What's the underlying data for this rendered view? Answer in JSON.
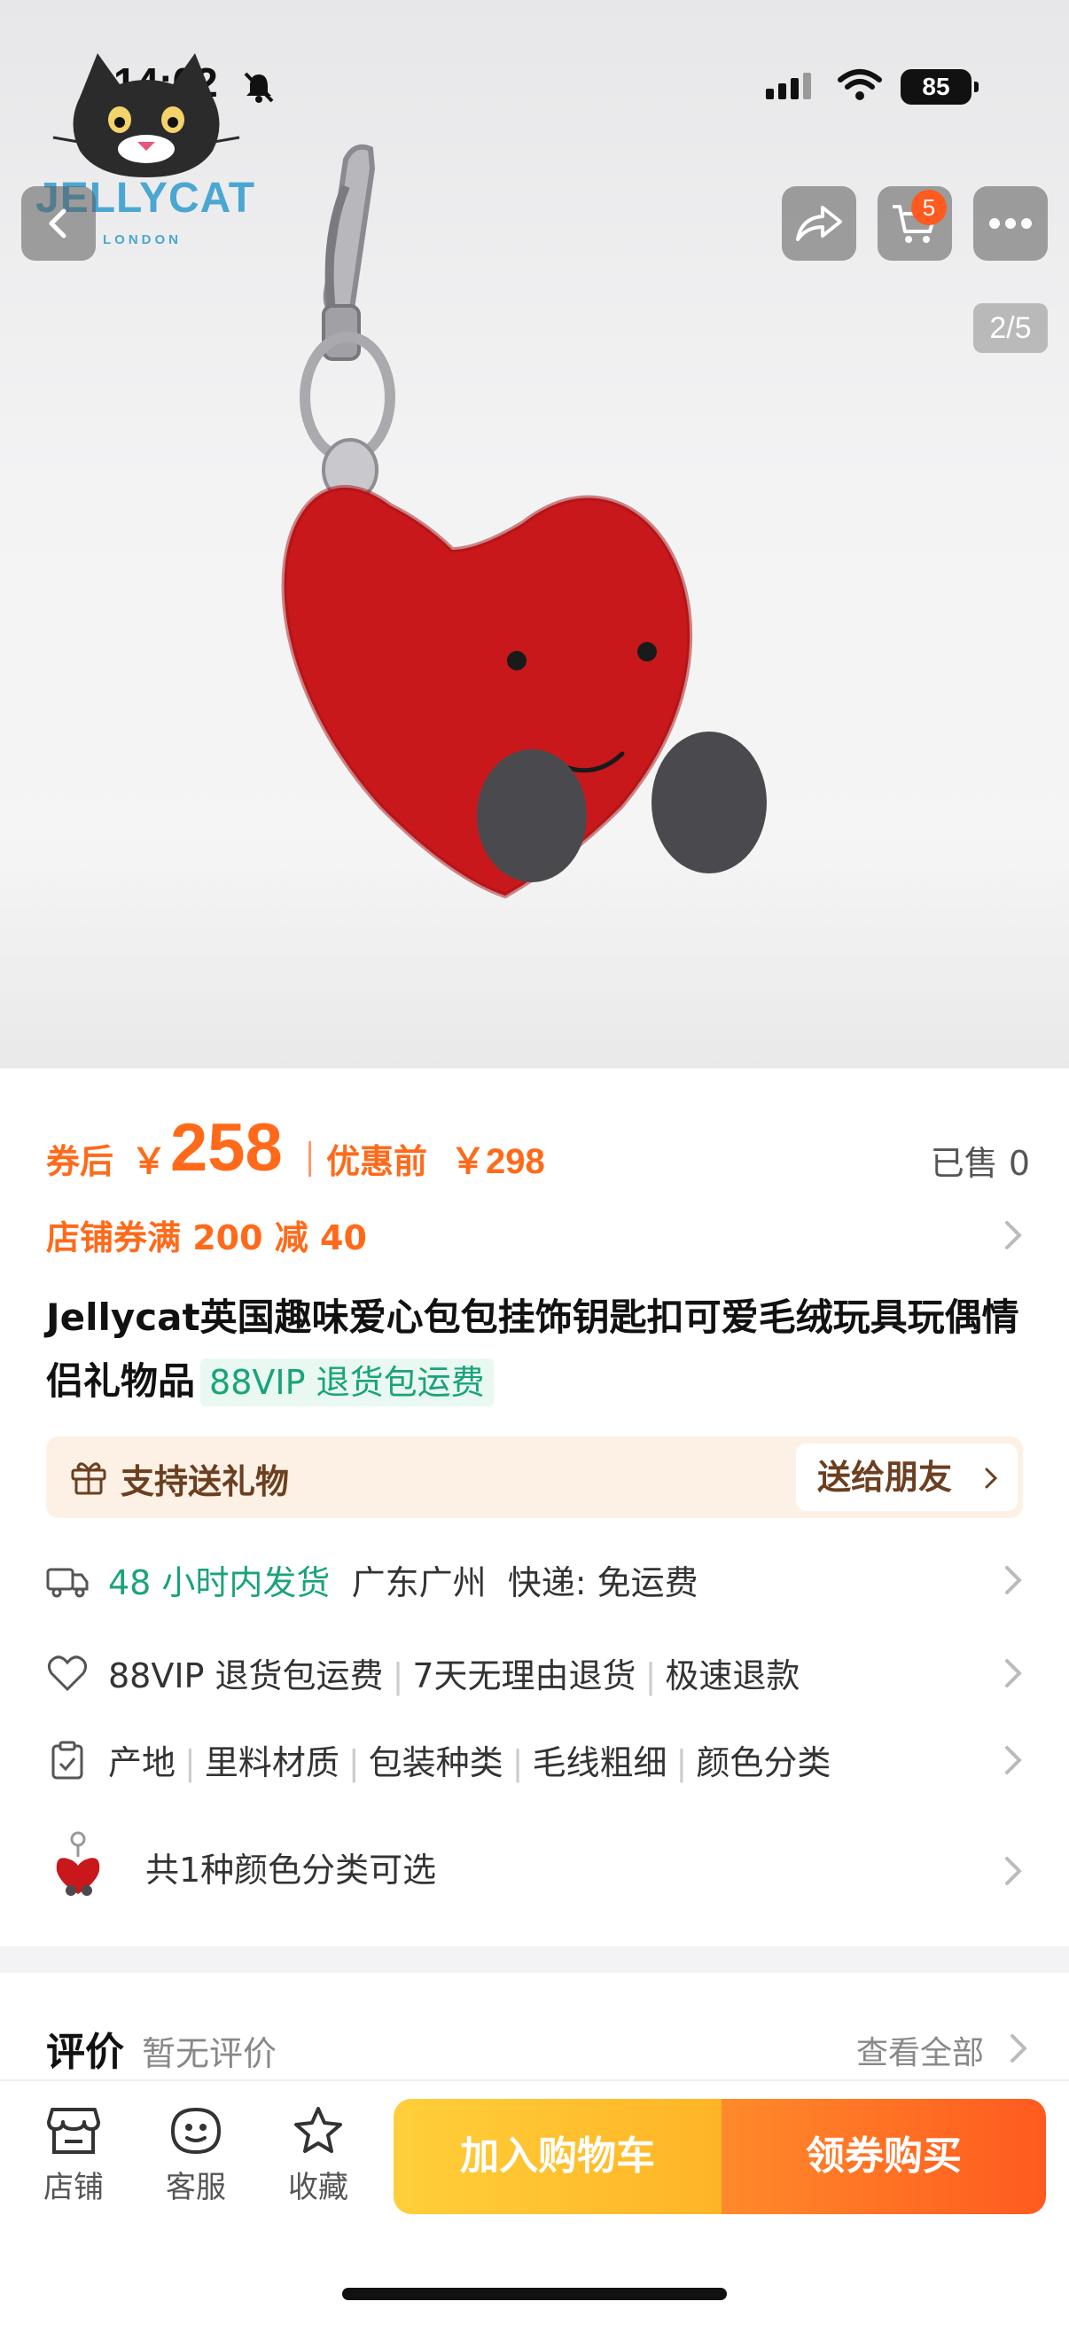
{
  "status_bar": {
    "time": "14:02",
    "battery": "85"
  },
  "brand": {
    "logo_text": "JELLYCAT",
    "logo_sub": "LONDON"
  },
  "header": {
    "cart_count": "5",
    "image_counter": "2/5"
  },
  "price": {
    "after_label": "券后",
    "currency": "￥",
    "after_value": "258",
    "before_label": "优惠前",
    "before_value": "￥298",
    "sold": "已售 0"
  },
  "coupon": {
    "text": "店铺券满 200 减 40"
  },
  "product": {
    "title": "Jellycat英国趣味爱心包包挂饰钥匙扣可爱毛绒玩具玩偶情侣礼物品",
    "vip_tag": "88VIP 退货包运费"
  },
  "gift": {
    "label": "支持送礼物",
    "button": "送给朋友"
  },
  "shipping": {
    "highlight": "48 小时内发货",
    "location": "广东广州",
    "courier": "快递: 免运费"
  },
  "service": {
    "items": [
      "88VIP 退货包运费",
      "7天无理由退货",
      "极速退款"
    ]
  },
  "params": {
    "items": [
      "产地",
      "里料材质",
      "包装种类",
      "毛线粗细",
      "颜色分类"
    ]
  },
  "variants": {
    "text": "共1种颜色分类可选"
  },
  "reviews": {
    "title": "评价",
    "status": "暂无评价",
    "view_all": "查看全部"
  },
  "bottom_bar": {
    "shop": "店铺",
    "service": "客服",
    "favorite": "收藏",
    "add_cart": "加入购物车",
    "buy": "领券购买"
  },
  "colors": {
    "accent": "#ff6a1a",
    "green": "#1aa37a",
    "gift_bg": "#fdf1e6"
  }
}
